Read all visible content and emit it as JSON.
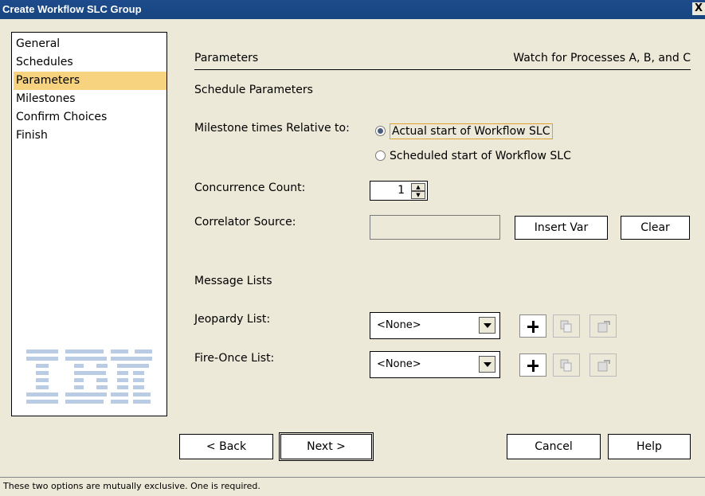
{
  "window": {
    "title": "Create Workflow SLC Group",
    "close_label": "X"
  },
  "nav": {
    "items": [
      "General",
      "Schedules",
      "Parameters",
      "Milestones",
      "Confirm Choices",
      "Finish"
    ],
    "selected": "Parameters"
  },
  "logo": {
    "text": "IBM"
  },
  "header": {
    "left": "Parameters",
    "right": "Watch for Processes A, B, and C"
  },
  "schedule_params": {
    "heading": "Schedule Parameters",
    "milestone_label": "Milestone times Relative to:",
    "radio_actual": "Actual start of Workflow SLC",
    "radio_scheduled": "Scheduled start of Workflow SLC",
    "selected": "actual"
  },
  "concurrence": {
    "label": "Concurrence Count:",
    "value": "1"
  },
  "correlator": {
    "label": "Correlator Source:",
    "value": "",
    "insert_label": "Insert Var",
    "clear_label": "Clear"
  },
  "messages": {
    "heading": "Message Lists",
    "jeopardy_label": "Jeopardy List:",
    "jeopardy_value": "<None>",
    "fireonce_label": "Fire-Once List:",
    "fireonce_value": "<None>"
  },
  "footer": {
    "back": "< Back",
    "next": "Next >",
    "cancel": "Cancel",
    "help": "Help"
  },
  "status": "These two options are mutually exclusive. One is required.",
  "colors": {
    "titlebar": "#1E4B8C",
    "selection": "#F7D37F",
    "dialog_bg": "#ECE9D8"
  }
}
